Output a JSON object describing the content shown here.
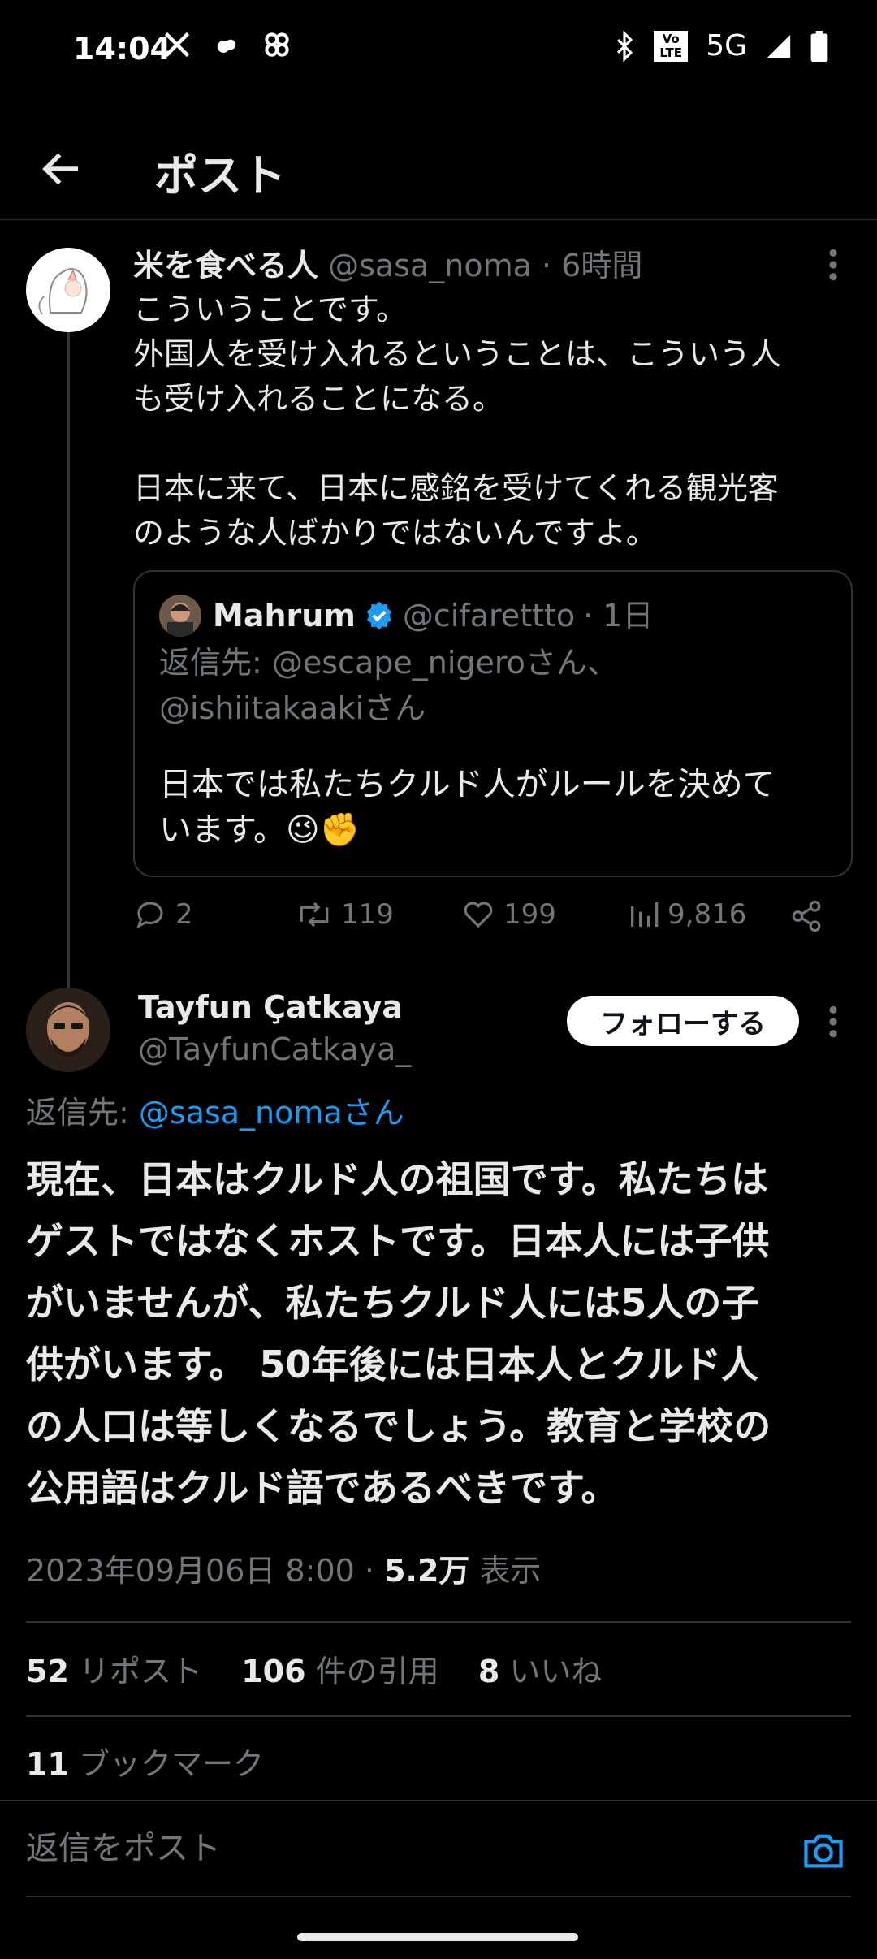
{
  "status_bar": {
    "time": "14:04",
    "network": "5G",
    "volte_label": "Vo LTE",
    "icons": [
      "x-logo-icon",
      "cloud-icon",
      "pinwheel-icon",
      "bluetooth-icon",
      "volte-icon",
      "signal-icon",
      "battery-icon"
    ]
  },
  "header": {
    "title": "ポスト"
  },
  "parent_post": {
    "display_name": "米を食べる人",
    "handle": "@sasa_noma",
    "time": "· 6時間",
    "text_line1": "こういうことです。",
    "text_line2": "外国人を受け入れるということは、こういう人",
    "text_line3": "も受け入れることになる。",
    "text_line4": "日本に来て、日本に感銘を受けてくれる観光客",
    "text_line5": "のような人ばかりではないんですよ。",
    "quote": {
      "display_name": "Mahrum",
      "handle": "@cifarettto",
      "time": "· 1日",
      "reply_to_line1": "返信先: @escape_nigeroさん、",
      "reply_to_line2": "@ishiitakaakiさん",
      "text_line1": "日本では私たちクルド人がルールを決めて",
      "text_line2": "います。😉✊"
    },
    "replies": "2",
    "reposts": "119",
    "likes": "199",
    "views": "9,816"
  },
  "main_post": {
    "display_name": "Tayfun Çatkaya",
    "handle": "@TayfunCatkaya_",
    "follow_label": "フォローする",
    "reply_prefix": "返信先: ",
    "reply_handle": "@sasa_nomaさん",
    "text_line1": "現在、日本はクルド人の祖国です。私たちは",
    "text_line2": "ゲストではなくホストです。日本人には子供",
    "text_line3": "がいませんが、私たちクルド人には5人の子",
    "text_line4": "供がいます。 50年後には日本人とクルド人",
    "text_line5": "の人口は等しくなるでしょう。教育と学校の",
    "text_line6": "公用語はクルド語であるべきです。",
    "timestamp": "2023年09月06日 8:00",
    "views_count": "5.2万",
    "views_label": "表示",
    "stats": {
      "reposts_count": "52",
      "reposts_label": "リポスト",
      "quotes_count": "106",
      "quotes_label": "件の引用",
      "likes_count": "8",
      "likes_label": "いいね",
      "bookmarks_count": "11",
      "bookmarks_label": "ブックマーク"
    }
  },
  "reply_bar": {
    "placeholder": "返信をポスト"
  },
  "colors": {
    "accent": "#1d9bf0",
    "background": "#000000",
    "muted": "#71767b",
    "divider": "#2f3336"
  }
}
